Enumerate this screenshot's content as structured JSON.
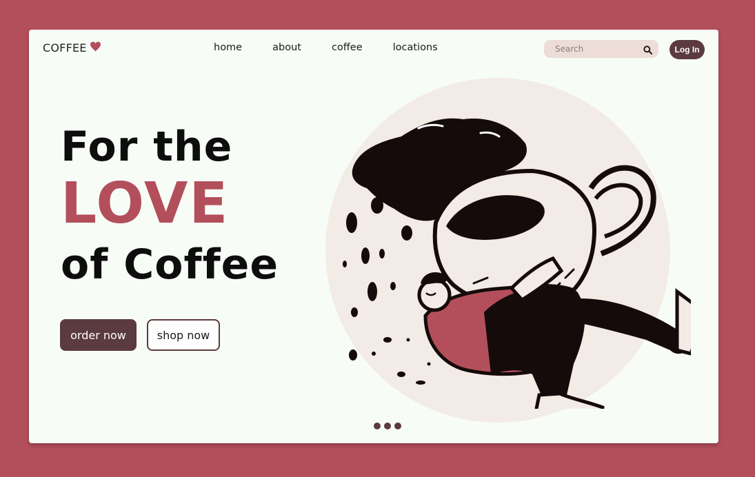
{
  "brand": {
    "name": "COFFEE",
    "icon": "heart-icon",
    "accent": "#b34f5b"
  },
  "nav": {
    "items": [
      "home",
      "about",
      "coffee",
      "locations"
    ]
  },
  "search": {
    "placeholder": "Search",
    "icon": "search-icon"
  },
  "login": {
    "label": "Log In"
  },
  "hero": {
    "line1": "For the",
    "line2": "LOVE",
    "line3": "of Coffee",
    "order_label": "order now",
    "shop_label": "shop now"
  },
  "carousel": {
    "dot_count": 3
  },
  "colors": {
    "page_bg": "#b34f5b",
    "card_bg": "#f7fdf6",
    "dark": "#5b3a40",
    "circle": "#f2ebe6"
  }
}
